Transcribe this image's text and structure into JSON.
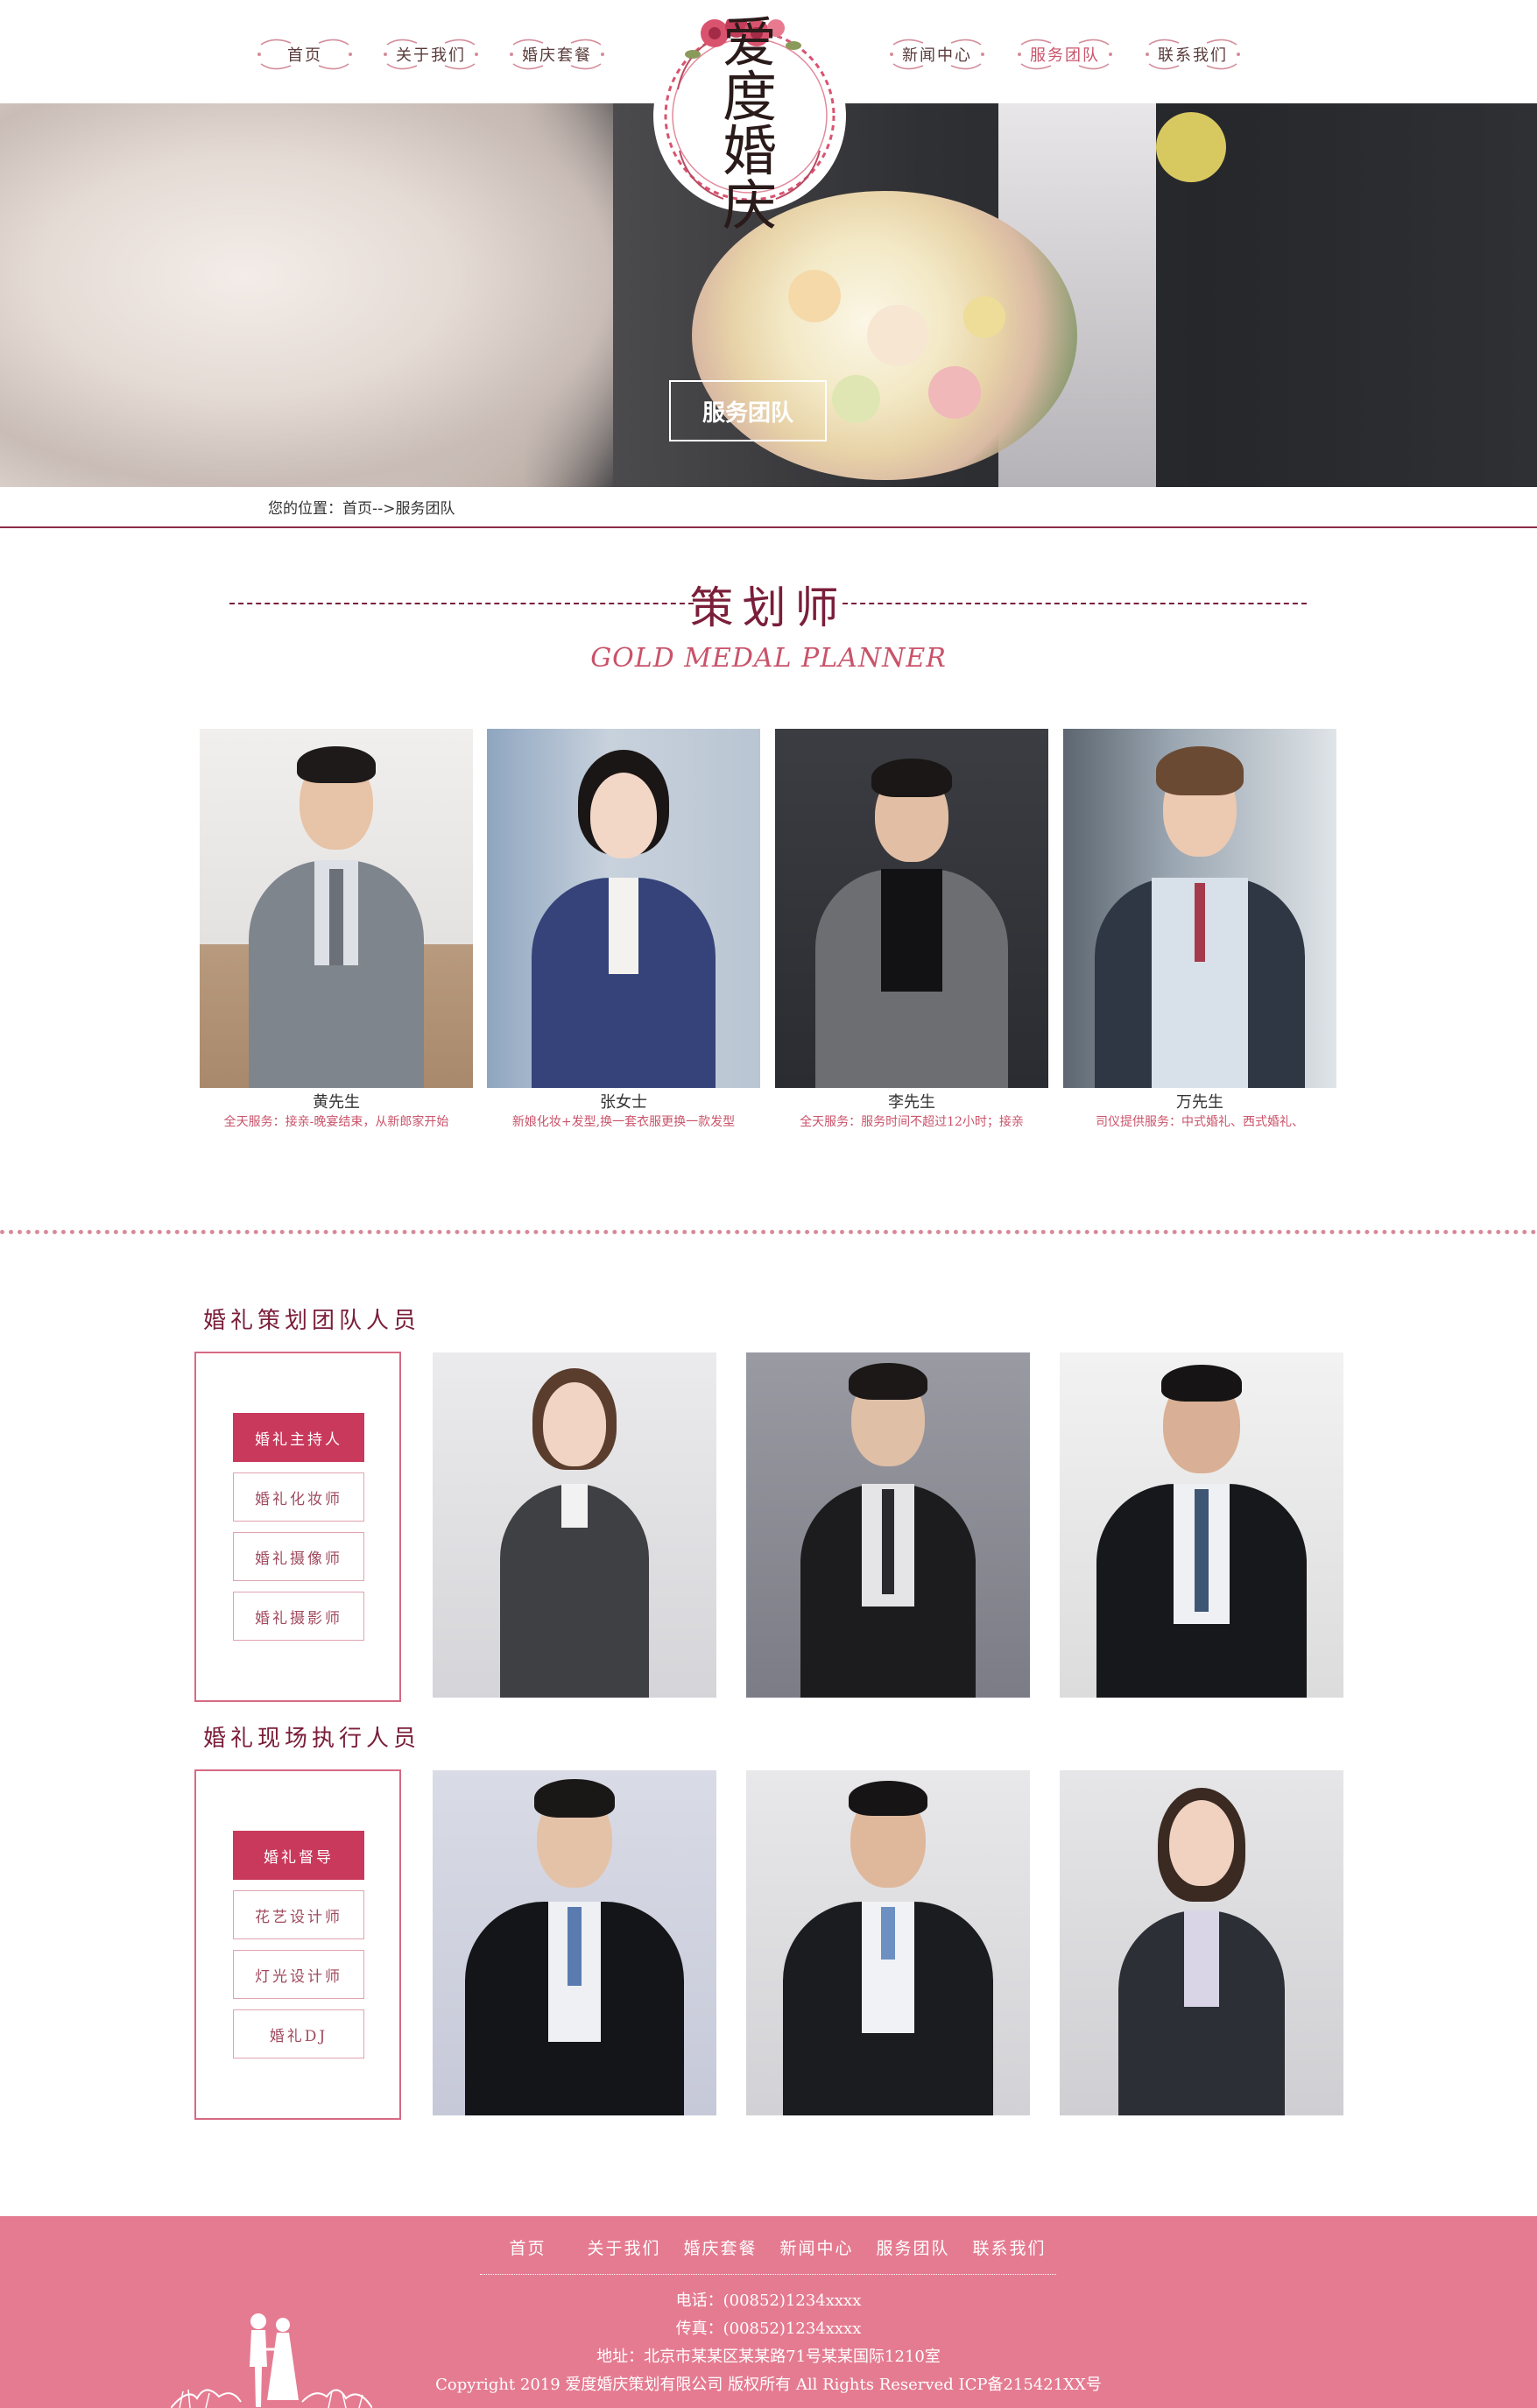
{
  "nav": {
    "left": [
      "首页",
      "关于我们",
      "婚庆套餐"
    ],
    "right": [
      "新闻中心",
      "服务团队",
      "联系我们"
    ],
    "active": "服务团队"
  },
  "logo": {
    "line1": "爱度",
    "line2": "婚庆"
  },
  "banner": {
    "button": "服务团队"
  },
  "breadcrumb": {
    "text": "您的位置：首页-->服务团队"
  },
  "planner_section": {
    "title": "策划师",
    "subtitle": "GOLD MEDAL PLANNER",
    "planners": [
      {
        "name": "黄先生",
        "desc": "全天服务：接亲-晚宴结束，从新郎家开始"
      },
      {
        "name": "张女士",
        "desc": "新娘化妆+发型,换一套衣服更换一款发型"
      },
      {
        "name": "李先生",
        "desc": "全天服务：服务时间不超过12小时；接亲"
      },
      {
        "name": "万先生",
        "desc": "司仪提供服务：中式婚礼、西式婚礼、"
      }
    ]
  },
  "team_planning": {
    "title": "婚礼策划团队人员",
    "roles": [
      "婚礼主持人",
      "婚礼化妆师",
      "婚礼摄像师",
      "婚礼摄影师"
    ],
    "active_role": "婚礼主持人"
  },
  "team_execution": {
    "title": "婚礼现场执行人员",
    "roles": [
      "婚礼督导",
      "花艺设计师",
      "灯光设计师",
      "婚礼DJ"
    ],
    "active_role": "婚礼督导"
  },
  "footer": {
    "nav": [
      "首页",
      "关于我们",
      "婚庆套餐",
      "新闻中心",
      "服务团队",
      "联系我们"
    ],
    "phone": "电话：(00852)1234xxxx",
    "fax": "传真：(00852)1234xxxx",
    "address": "地址：北京市某某区某某路71号某某国际1210室",
    "copyright": "Copyright 2019 爱度婚庆策划有限公司 版权所有 All Rights Reserved ICP备215421XX号"
  },
  "colors": {
    "accent": "#c9395c",
    "dark_accent": "#7a1e3a",
    "footer_bg": "#e57b91"
  }
}
